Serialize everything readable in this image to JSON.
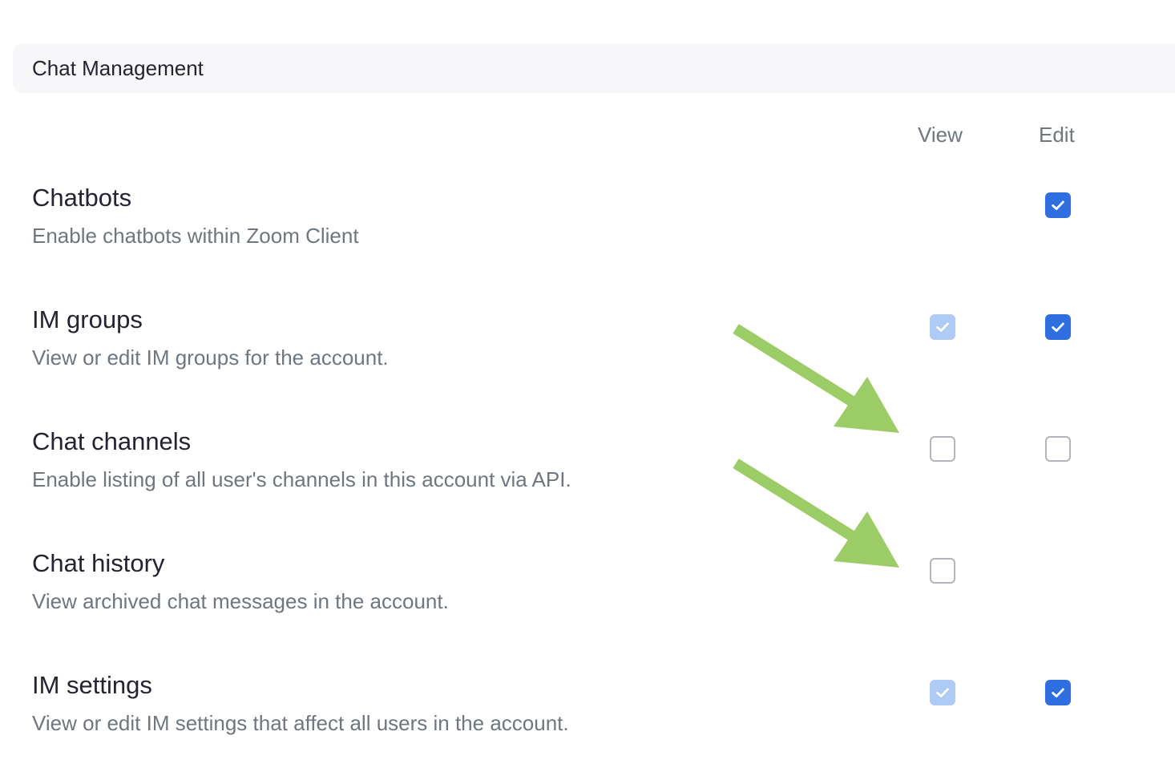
{
  "section": {
    "title": "Chat Management"
  },
  "columns": {
    "view": "View",
    "edit": "Edit"
  },
  "rows": [
    {
      "title": "Chatbots",
      "description": "Enable chatbots within Zoom Client",
      "view": "none",
      "edit": "checked"
    },
    {
      "title": "IM groups",
      "description": "View or edit IM groups for the account.",
      "view": "checked-disabled",
      "edit": "checked"
    },
    {
      "title": "Chat channels",
      "description": "Enable listing of all user's channels in this account via API.",
      "view": "unchecked",
      "edit": "unchecked"
    },
    {
      "title": "Chat history",
      "description": "View archived chat messages in the account.",
      "view": "unchecked",
      "edit": "none"
    },
    {
      "title": "IM settings",
      "description": "View or edit IM settings that affect all users in the account.",
      "view": "checked-disabled",
      "edit": "checked"
    }
  ],
  "colors": {
    "checked": "#2d6fe0",
    "checked_disabled": "#aecbf5",
    "arrow": "#9ccc65"
  },
  "icons": {
    "check": "check-icon",
    "arrow": "arrow-annotation-icon"
  }
}
